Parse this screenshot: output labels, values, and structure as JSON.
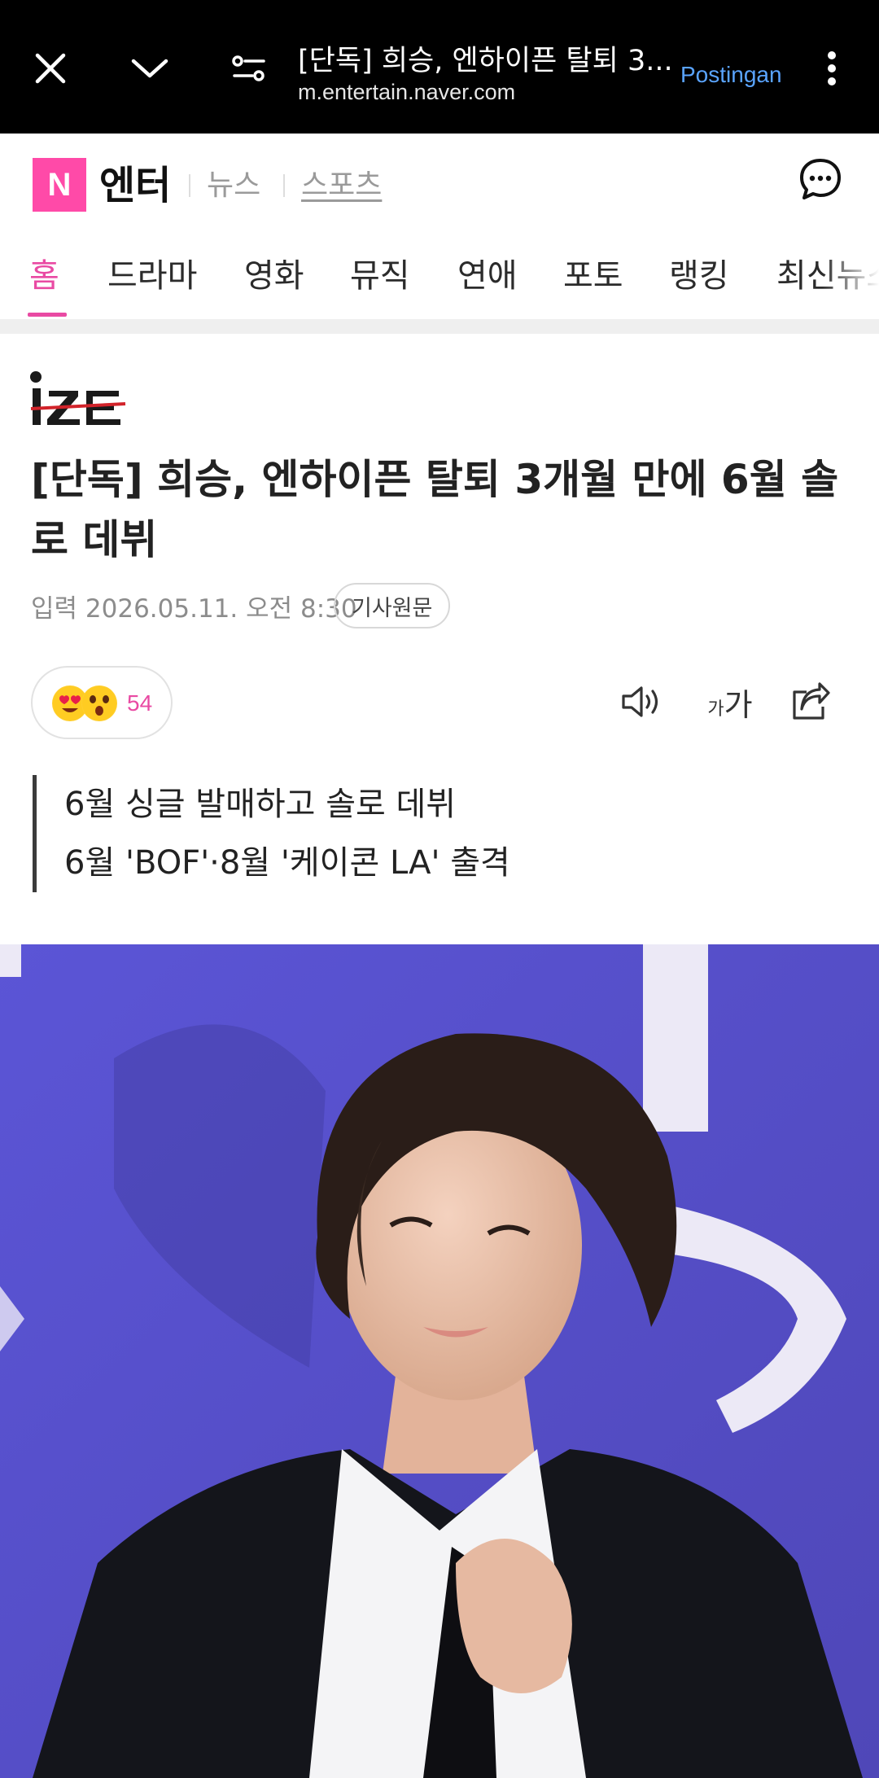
{
  "browser": {
    "title": "[단독] 희승, 엔하이픈 탈퇴 3...",
    "url": "m.entertain.naver.com",
    "action_label": "Postingan",
    "icons": [
      "close-icon",
      "chevron-down-icon",
      "tune-icon",
      "more-vert-icon"
    ]
  },
  "header": {
    "logo_letter": "N",
    "brand": "엔터",
    "links": [
      "뉴스",
      "스포츠"
    ],
    "accent_color": "#ff4aa8"
  },
  "tabs": [
    "홈",
    "드라마",
    "영화",
    "뮤직",
    "연애",
    "포토",
    "랭킹",
    "최신뉴스"
  ],
  "article": {
    "press": "IZE",
    "headline": "[단독] 희승, 엔하이픈 탈퇴 3개월 만에 6월 솔로 데뷔",
    "date": "입력 2026.05.11. 오전 8:30",
    "original_label": "기사원문",
    "reaction_count": "54",
    "font_label_small": "가",
    "font_label_large": "가",
    "summary": [
      "6월 싱글 발매하고 솔로 데뷔",
      "6월 'BOF'·8월 '케이콘 LA' 출격"
    ]
  }
}
